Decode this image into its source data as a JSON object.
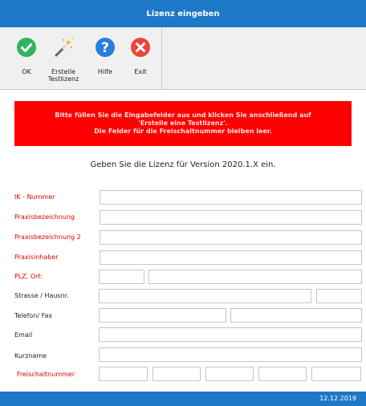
{
  "window": {
    "title": "Lizenz eingeben"
  },
  "toolbar": {
    "ok_label": "OK",
    "testlizenz_label": "Erstelle\nTestlizenz",
    "help_label": "Hilfe",
    "exit_label": "Exit",
    "icons": [
      "check-circle-icon",
      "magic-wand-icon",
      "question-circle-icon",
      "close-circle-icon"
    ],
    "colors": {
      "ok": "#2fb560",
      "help": "#2a7de1",
      "exit": "#e8463c"
    }
  },
  "banner": {
    "text": "Bitte füllen Sie die Eingabefelder aus und klicken Sie anschließend auf\n'Erstelle eine Testlizenz'.\nDie Felder für die Freischaltnummer bleiben leer.",
    "color": "#ff0000"
  },
  "headline": "Geben Sie die Lizenz für Version 2020.1.X ein.",
  "form": {
    "ik_label": "IK - Nummer",
    "praxis_label": "Praxisbezeichnung",
    "praxis2_label": "Praxisbezeichnung 2",
    "inhaber_label": "Praxisinhaber",
    "plz_label": "PLZ, Ort:",
    "strasse_label": "Strasse / Hausnr.",
    "telefon_label": "Telefon/ Fax",
    "email_label": "Email",
    "kurzname_label": "Kurzname",
    "freischalt_label": "Freischaltnummer",
    "values": {
      "ik": "",
      "praxis": "",
      "praxis2": "",
      "inhaber": "",
      "plz": "",
      "ort": "",
      "strasse": "",
      "hausnr": "",
      "telefon": "",
      "fax": "",
      "email": "",
      "kurzname": "",
      "freischalt1": "",
      "freischalt2": "",
      "freischalt3": "",
      "freischalt4": "",
      "freischalt5": ""
    }
  },
  "footer": {
    "date": "12.12.2019"
  }
}
